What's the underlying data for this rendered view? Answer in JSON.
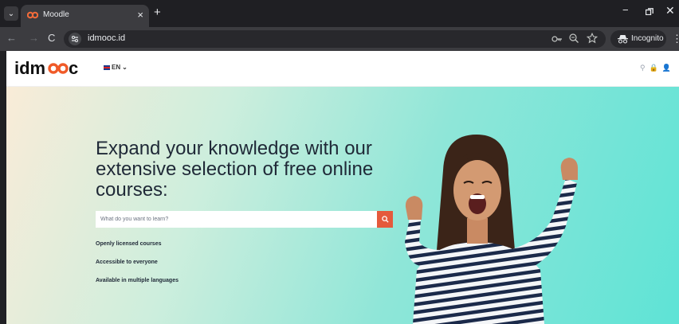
{
  "browser": {
    "tab_title": "Moodle",
    "url": "idmooc.id",
    "incognito_label": "Incognito",
    "tab_close_glyph": "×",
    "new_tab_glyph": "+",
    "minimize_glyph": "−",
    "close_glyph": "✕",
    "back_glyph": "←",
    "forward_glyph": "→",
    "reload_glyph": "C",
    "menu_glyph": "⋮",
    "tab_menu_glyph": "⌄",
    "icons": [
      "tab-search-icon",
      "moodle-favicon",
      "back-arrow-icon",
      "forward-arrow-icon",
      "reload-icon",
      "site-info-icon",
      "key-icon",
      "zoom-icon",
      "star-icon",
      "incognito-icon",
      "kebab-menu-icon"
    ]
  },
  "site": {
    "logo_text": "idmooc",
    "language": "EN",
    "language_chevron": "⌄",
    "header_icons": [
      "search-icon",
      "lock-icon",
      "user-icon"
    ],
    "search_glyph": "⚲",
    "lock_glyph": "🔒",
    "user_glyph": "👤"
  },
  "hero": {
    "headline": "Expand your knowledge with our extensive selection of free online courses:",
    "search_placeholder": "What do you want to learn?",
    "features": [
      "Openly licensed courses",
      "Accessible to everyone",
      "Available in multiple languages"
    ]
  },
  "colors": {
    "accent": "#e55a3c",
    "logo_dark": "#111111",
    "logo_ring": "#f05a28",
    "hero_teal": "#5ee3d6"
  }
}
